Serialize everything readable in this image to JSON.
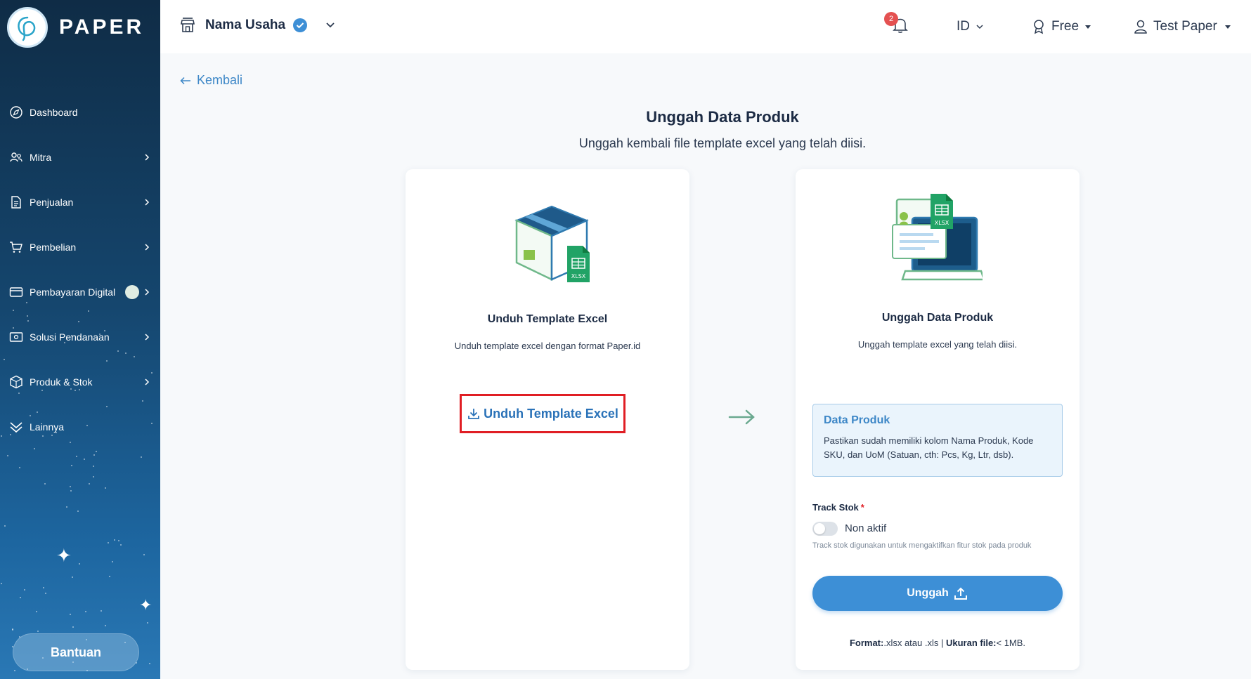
{
  "brand": {
    "name": "PAPER"
  },
  "sidebar": {
    "items": [
      {
        "label": "Dashboard",
        "icon": "compass-icon",
        "has_chevron": false
      },
      {
        "label": "Mitra",
        "icon": "users-icon",
        "has_chevron": true
      },
      {
        "label": "Penjualan",
        "icon": "document-icon",
        "has_chevron": true
      },
      {
        "label": "Pembelian",
        "icon": "cart-icon",
        "has_chevron": true
      },
      {
        "label": "Pembayaran Digital",
        "icon": "card-icon",
        "has_chevron": true
      },
      {
        "label": "Solusi Pendanaan",
        "icon": "wallet-icon",
        "has_chevron": true
      },
      {
        "label": "Produk & Stok",
        "icon": "box-icon",
        "has_chevron": true
      },
      {
        "label": "Lainnya",
        "icon": "chevrons-down-icon",
        "has_chevron": false
      }
    ],
    "help_label": "Bantuan"
  },
  "header": {
    "business_name": "Nama Usaha",
    "notification_count": "2",
    "language": "ID",
    "plan": "Free",
    "user_name": "Test Paper"
  },
  "main": {
    "back_label": "Kembali",
    "title": "Unggah Data Produk",
    "subtitle": "Unggah kembali file template excel yang telah diisi.",
    "download_card": {
      "title": "Unduh Template Excel",
      "description": "Unduh template excel dengan format Paper.id",
      "button_label": "Unduh Template Excel",
      "file_badge": "XLSX"
    },
    "upload_card": {
      "title": "Unggah Data Produk",
      "description": "Unggah template excel yang telah diisi.",
      "file_badge": "XLSX",
      "info_title": "Data Produk",
      "info_text": "Pastikan sudah memiliki kolom Nama Produk, Kode SKU, dan UoM (Satuan, cth: Pcs, Kg, Ltr, dsb).",
      "track_label": "Track Stok",
      "required_mark": "*",
      "toggle_state": "Non aktif",
      "track_help": "Track stok digunakan untuk mengaktifkan fitur stok pada produk",
      "upload_button": "Unggah",
      "format_label": "Format:",
      "format_value": ".xlsx atau .xls",
      "separator": " | ",
      "size_label": "Ukuran file:",
      "size_value": "< 1MB."
    }
  },
  "colors": {
    "accent": "#3d8fd6",
    "link": "#3d87c7",
    "highlight_border": "#e01e24",
    "excel_green": "#21a366",
    "badge_red": "#e45151"
  }
}
